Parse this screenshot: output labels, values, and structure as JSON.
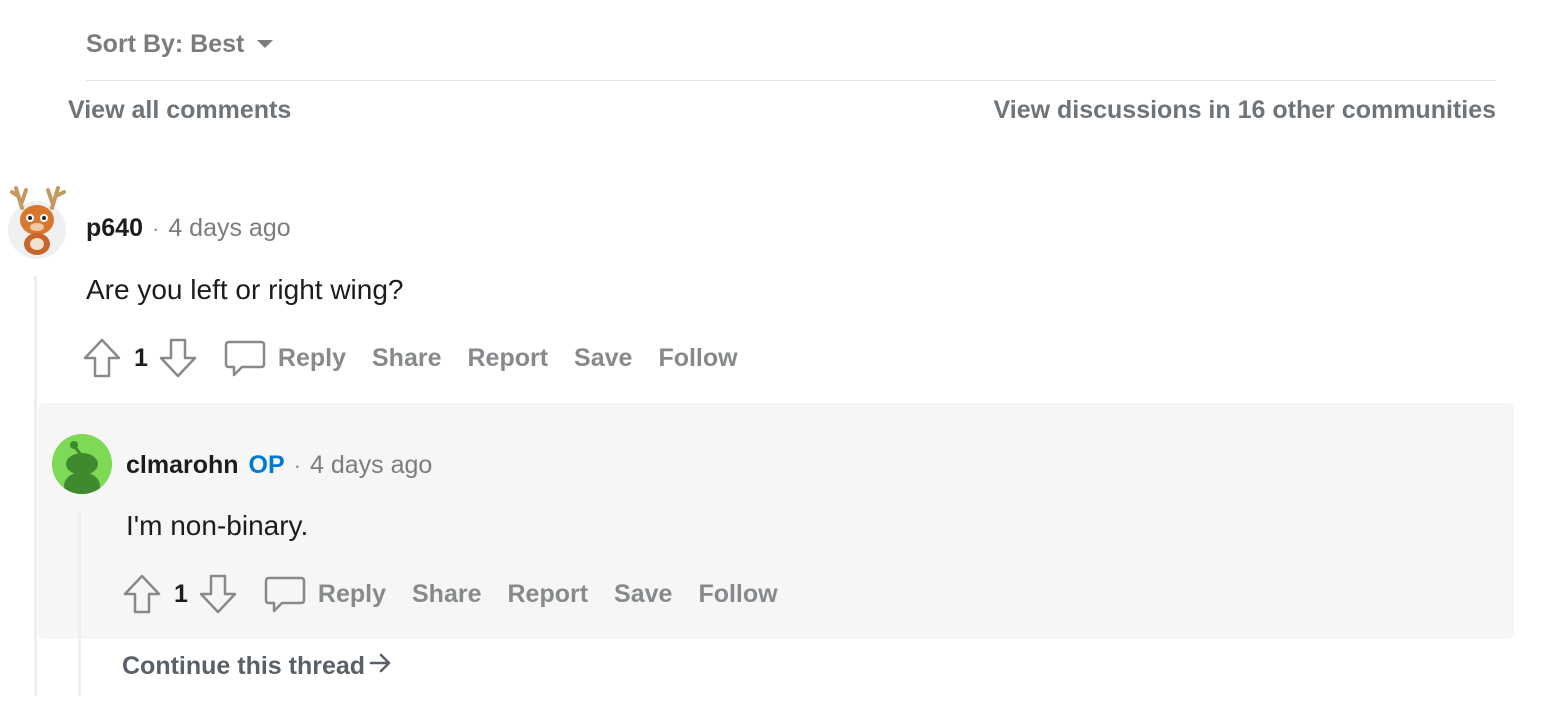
{
  "sort": {
    "label": "Sort By: Best"
  },
  "links": {
    "view_all": "View all comments",
    "view_discussions": "View discussions in 16 other communities"
  },
  "comments": [
    {
      "author": "p640",
      "separator": "·",
      "time": "4 days ago",
      "body": "Are you left or right wing?",
      "score": "1",
      "actions": [
        "Reply",
        "Share",
        "Report",
        "Save",
        "Follow"
      ]
    },
    {
      "author": "clmarohn",
      "badge": "OP",
      "separator": "·",
      "time": "4 days ago",
      "body": "I'm non-binary.",
      "score": "1",
      "actions": [
        "Reply",
        "Share",
        "Report",
        "Save",
        "Follow"
      ]
    }
  ],
  "continue_thread": "Continue this thread",
  "colors": {
    "op_badge": "#0079d3",
    "highlight_bg": "#f6f6f6",
    "avatar2_bg": "#7ed957",
    "avatar2_figure": "#3f8a2e",
    "muted_text": "#878a8c"
  }
}
